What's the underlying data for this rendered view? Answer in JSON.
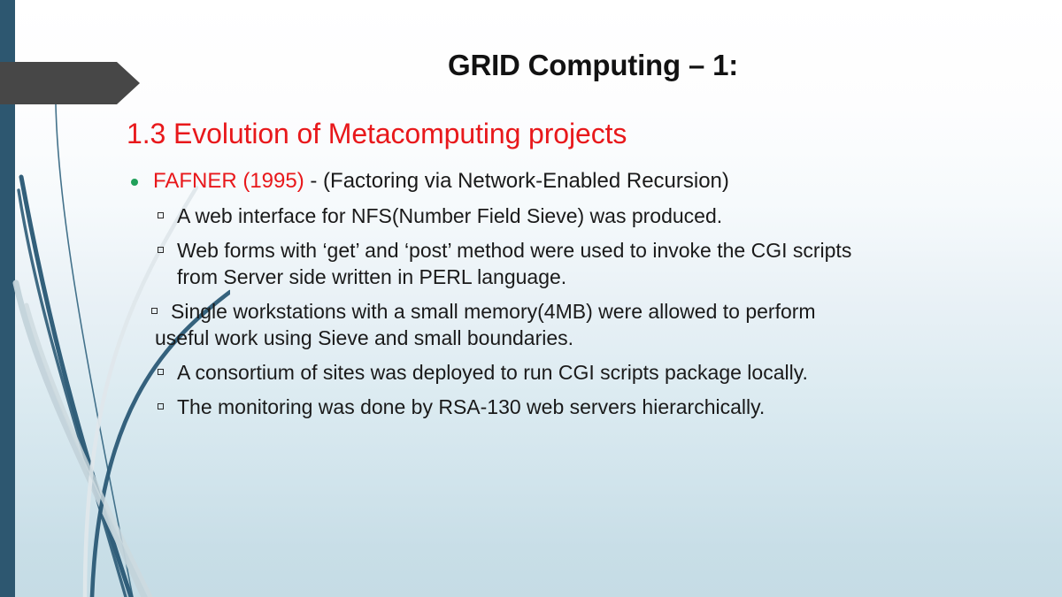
{
  "slide": {
    "title": "GRID Computing – 1:",
    "section_heading": "1.3 Evolution of Metacomputing projects",
    "colors": {
      "left_bar": "#2d5770",
      "arrow_banner": "#474747",
      "title_text": "#121212",
      "heading_red": "#e8181b",
      "bullet_green": "#21a05a",
      "body_text": "#1a1a1a",
      "background_top": "#ffffff",
      "background_bottom": "#c5dce5",
      "swoosh_dark": "#2b5a76",
      "swoosh_light": "#c3d3da"
    },
    "bullets": {
      "main": {
        "highlight": "FAFNER (1995)",
        "rest": " - (Factoring via Network-Enabled Recursion)"
      },
      "sub": [
        {
          "text": "A web interface for NFS(Number Field Sieve) was produced."
        },
        {
          "text": "Web forms with ‘get’ and ‘post’ method were used to invoke the CGI scripts"
        },
        {
          "text": "Single workstations with a small memory(4MB) were allowed to perform"
        },
        {
          "text": "A consortium of sites was deployed to run CGI scripts package locally."
        },
        {
          "text": "The monitoring was done by RSA-130 web servers hierarchically."
        }
      ],
      "continuations": {
        "line_a": "from Server  side written in PERL language.",
        "line_b": "useful work using Sieve and small boundaries."
      }
    }
  }
}
